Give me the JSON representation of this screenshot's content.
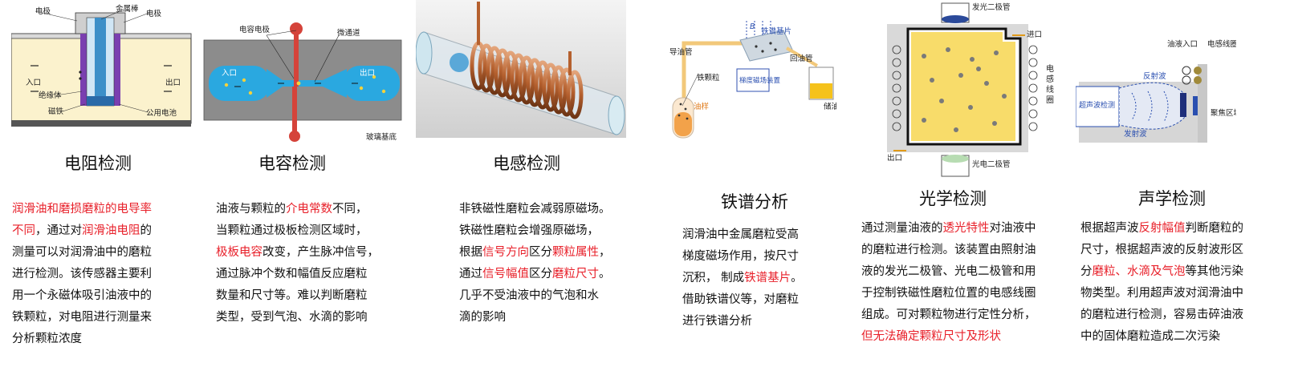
{
  "panels": [
    {
      "title": "电阻检测",
      "figure_labels": {
        "electrode_left": "电极",
        "metal_rod": "金属棒",
        "electrode_right": "电极",
        "inlet": "入口",
        "outlet": "出口",
        "insulator": "绝缘体",
        "magnet": "磁铁",
        "common_battery": "公用电池"
      },
      "description": [
        [
          {
            "text": "润滑油和磨损磨粒的电导率",
            "hl": true
          }
        ],
        [
          {
            "text": "不同",
            "hl": true
          },
          {
            "text": "，通过对",
            "hl": false
          },
          {
            "text": "润滑油电阻",
            "hl": true
          },
          {
            "text": "的",
            "hl": false
          }
        ],
        [
          {
            "text": "测量可以对润滑油中的磨粒",
            "hl": false
          }
        ],
        [
          {
            "text": "进行检测。该传感器主要利",
            "hl": false
          }
        ],
        [
          {
            "text": "用一个永磁体吸引油液中的",
            "hl": false
          }
        ],
        [
          {
            "text": "铁颗粒，对电阻进行测量来",
            "hl": false
          }
        ],
        [
          {
            "text": "分析颗粒浓度",
            "hl": false
          }
        ]
      ]
    },
    {
      "title": "电容检测",
      "figure_labels": {
        "cap_electrode": "电容电极",
        "microchannel": "微通道",
        "inlet": "入口",
        "outlet": "出口",
        "glass_substrate": "玻璃基底"
      },
      "description": [
        [
          {
            "text": "油液与颗粒的",
            "hl": false
          },
          {
            "text": "介电常数",
            "hl": true
          },
          {
            "text": "不同，",
            "hl": false
          }
        ],
        [
          {
            "text": "当颗粒通过极板检测区域时，",
            "hl": false
          }
        ],
        [
          {
            "text": "极板电容",
            "hl": true
          },
          {
            "text": "改变，产生脉冲信号，",
            "hl": false
          }
        ],
        [
          {
            "text": "通过脉冲个数和幅值反应磨粒",
            "hl": false
          }
        ],
        [
          {
            "text": "数量和尺寸等。难以判断磨粒",
            "hl": false
          }
        ],
        [
          {
            "text": "类型，受到气泡、水滴的影响",
            "hl": false
          }
        ]
      ]
    },
    {
      "title": "电感检测",
      "figure_labels": {},
      "description": [
        [
          {
            "text": "非铁磁性磨粒会减弱原磁场。",
            "hl": false
          }
        ],
        [
          {
            "text": "铁磁性磨粒会增强原磁场，",
            "hl": false
          }
        ],
        [
          {
            "text": "根据",
            "hl": false
          },
          {
            "text": "信号方向",
            "hl": true
          },
          {
            "text": "区分",
            "hl": false
          },
          {
            "text": "颗粒属性",
            "hl": true
          },
          {
            "text": "，",
            "hl": false
          }
        ],
        [
          {
            "text": "通过",
            "hl": false
          },
          {
            "text": "信号幅值",
            "hl": true
          },
          {
            "text": "区分",
            "hl": false
          },
          {
            "text": "磨粒尺寸",
            "hl": true
          },
          {
            "text": "。",
            "hl": false
          }
        ],
        [
          {
            "text": "几乎不受油液中的气泡和水",
            "hl": false
          }
        ],
        [
          {
            "text": "滴的影响",
            "hl": false
          }
        ]
      ]
    },
    {
      "title": "铁谱分析",
      "figure_labels": {
        "oil_guide_pipe": "导油管",
        "iron_particle": "铁颗粒",
        "oil_sample": "油样",
        "gradient_magnet": "梯度磁场装置",
        "ferrogram_substrate": "铁谱基片",
        "return_pipe": "回油管",
        "oil_cup": "储油杯",
        "b_field": "B"
      },
      "description": [
        [
          {
            "text": "润滑油中金属磨粒受高",
            "hl": false
          }
        ],
        [
          {
            "text": "梯度磁场作用，按尺寸",
            "hl": false
          }
        ],
        [
          {
            "text": "沉积，  制成",
            "hl": false
          },
          {
            "text": "铁谱基片",
            "hl": true
          },
          {
            "text": "。",
            "hl": false
          }
        ],
        [
          {
            "text": "借助铁谱仪等，对磨粒",
            "hl": false
          }
        ],
        [
          {
            "text": "进行铁谱分析",
            "hl": false
          }
        ]
      ]
    },
    {
      "title": "光学检测",
      "figure_labels": {
        "light_diode": "发光二极管",
        "inlet": "进口",
        "outlet": "出口",
        "inductor_coil": "电感线圈",
        "photodiode": "光电二极管"
      },
      "description": [
        [
          {
            "text": "通过测量油液的",
            "hl": false
          },
          {
            "text": "透光特性",
            "hl": true
          },
          {
            "text": "对油液中",
            "hl": false
          }
        ],
        [
          {
            "text": "的磨粒进行检测。该装置由照射油",
            "hl": false
          }
        ],
        [
          {
            "text": "液的发光二极管、光电二极管和用",
            "hl": false
          }
        ],
        [
          {
            "text": "于控制铁磁性磨粒位置的电感线圈",
            "hl": false
          }
        ],
        [
          {
            "text": "组成。可对颗粒物进行定性分析，",
            "hl": false
          }
        ],
        [
          {
            "text": "但无法确定颗粒尺寸及形状",
            "hl": true
          }
        ]
      ]
    },
    {
      "title": "声学检测",
      "figure_labels": {
        "oil_inlet": "油液入口",
        "inductor_coil": "电感线圈",
        "reflected_wave": "反射波",
        "ultrasonic": "超声波检测",
        "emitted_wave": "发射波",
        "focus_zone": "聚焦区域"
      },
      "description": [
        [
          {
            "text": "根据超声波",
            "hl": false
          },
          {
            "text": "反射幅值",
            "hl": true
          },
          {
            "text": "判断磨粒的",
            "hl": false
          }
        ],
        [
          {
            "text": "尺寸，根据超声波的反射波形区",
            "hl": false
          }
        ],
        [
          {
            "text": "分",
            "hl": false
          },
          {
            "text": "磨粒、水滴及气泡",
            "hl": true
          },
          {
            "text": "等其他污染",
            "hl": false
          }
        ],
        [
          {
            "text": "物类型。利用超声波对润滑油中",
            "hl": false
          }
        ],
        [
          {
            "text": "的磨粒进行检测，容易击碎油液",
            "hl": false
          }
        ],
        [
          {
            "text": "中的固体磨粒造成二次污染",
            "hl": false
          }
        ]
      ]
    }
  ]
}
